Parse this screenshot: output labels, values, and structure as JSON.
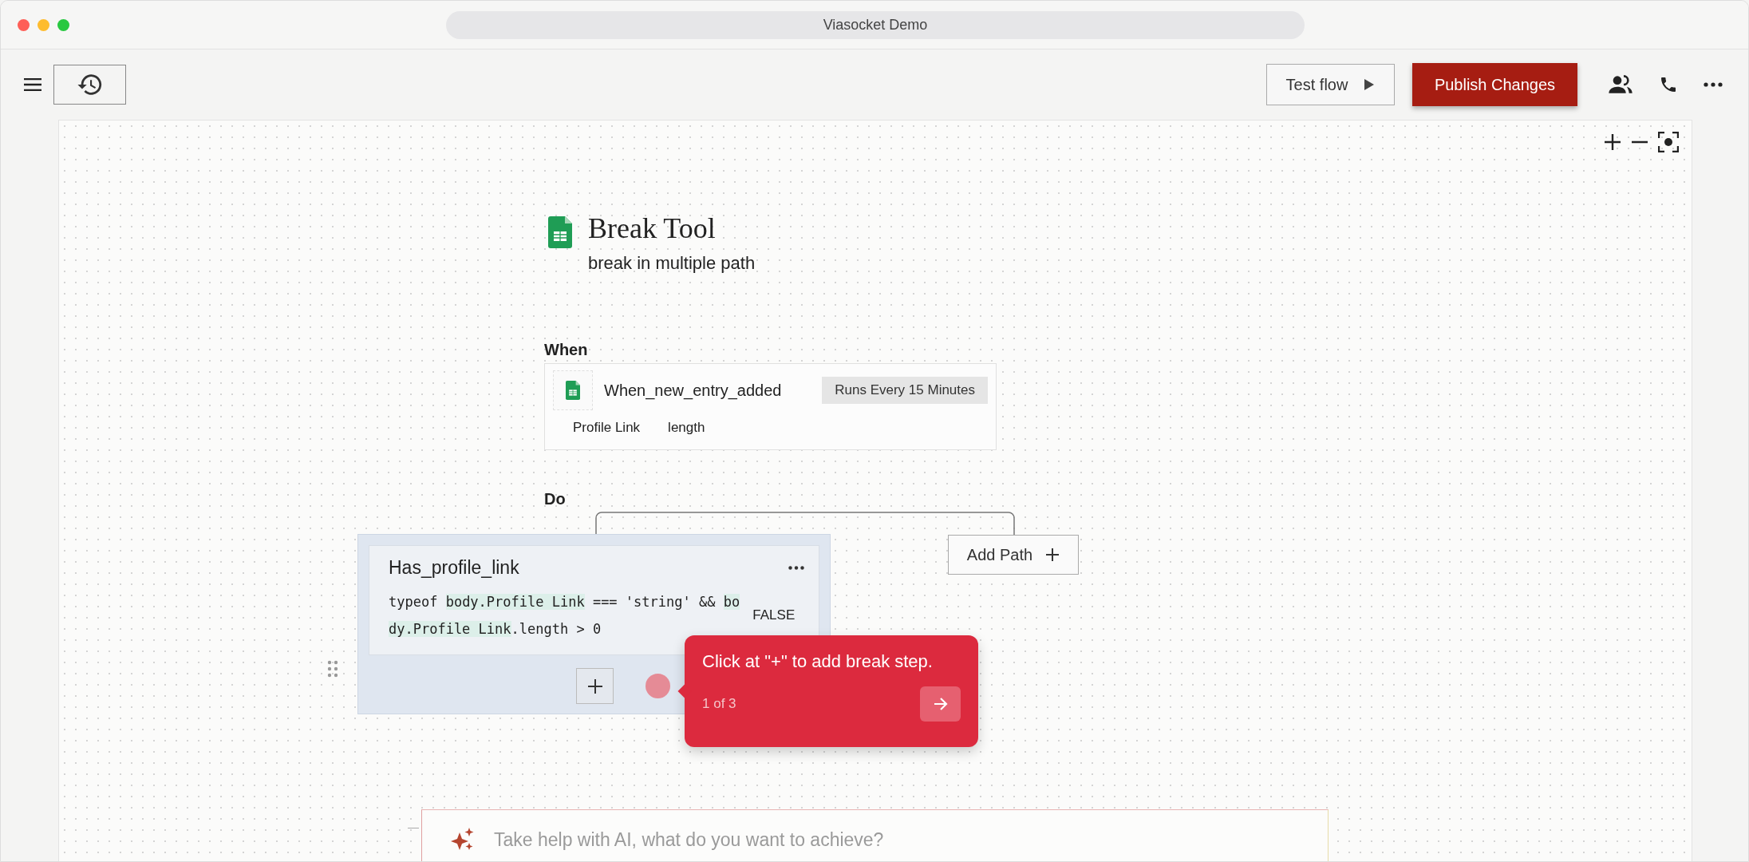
{
  "window": {
    "title": "Viasocket Demo"
  },
  "toolbar": {
    "test_button": "Test flow",
    "publish_button": "Publish Changes"
  },
  "flow": {
    "title": "Break Tool",
    "description": "break in multiple path",
    "trigger": {
      "heading": "When",
      "name": "When_new_entry_added",
      "schedule": "Runs Every 15 Minutes",
      "fields": [
        "Profile Link",
        "length"
      ]
    },
    "steps_heading": "Do",
    "branches": [
      {
        "name": "Has_profile_link",
        "result": "FALSE",
        "condition": [
          {
            "text": "typeof ",
            "highlight": false
          },
          {
            "text": "body.Profile Link",
            "highlight": true
          },
          {
            "text": " === 'string' && ",
            "highlight": false
          },
          {
            "text": "body.Profile Link",
            "highlight": true
          },
          {
            "text": ".length > 0",
            "highlight": false
          }
        ]
      }
    ],
    "add_path": "Add Path"
  },
  "tour": {
    "message": "Click at \"+\" to add break step.",
    "progress": "1 of 3"
  },
  "ai_prompt": {
    "placeholder": "Take help with AI, what do you want to achieve?"
  }
}
